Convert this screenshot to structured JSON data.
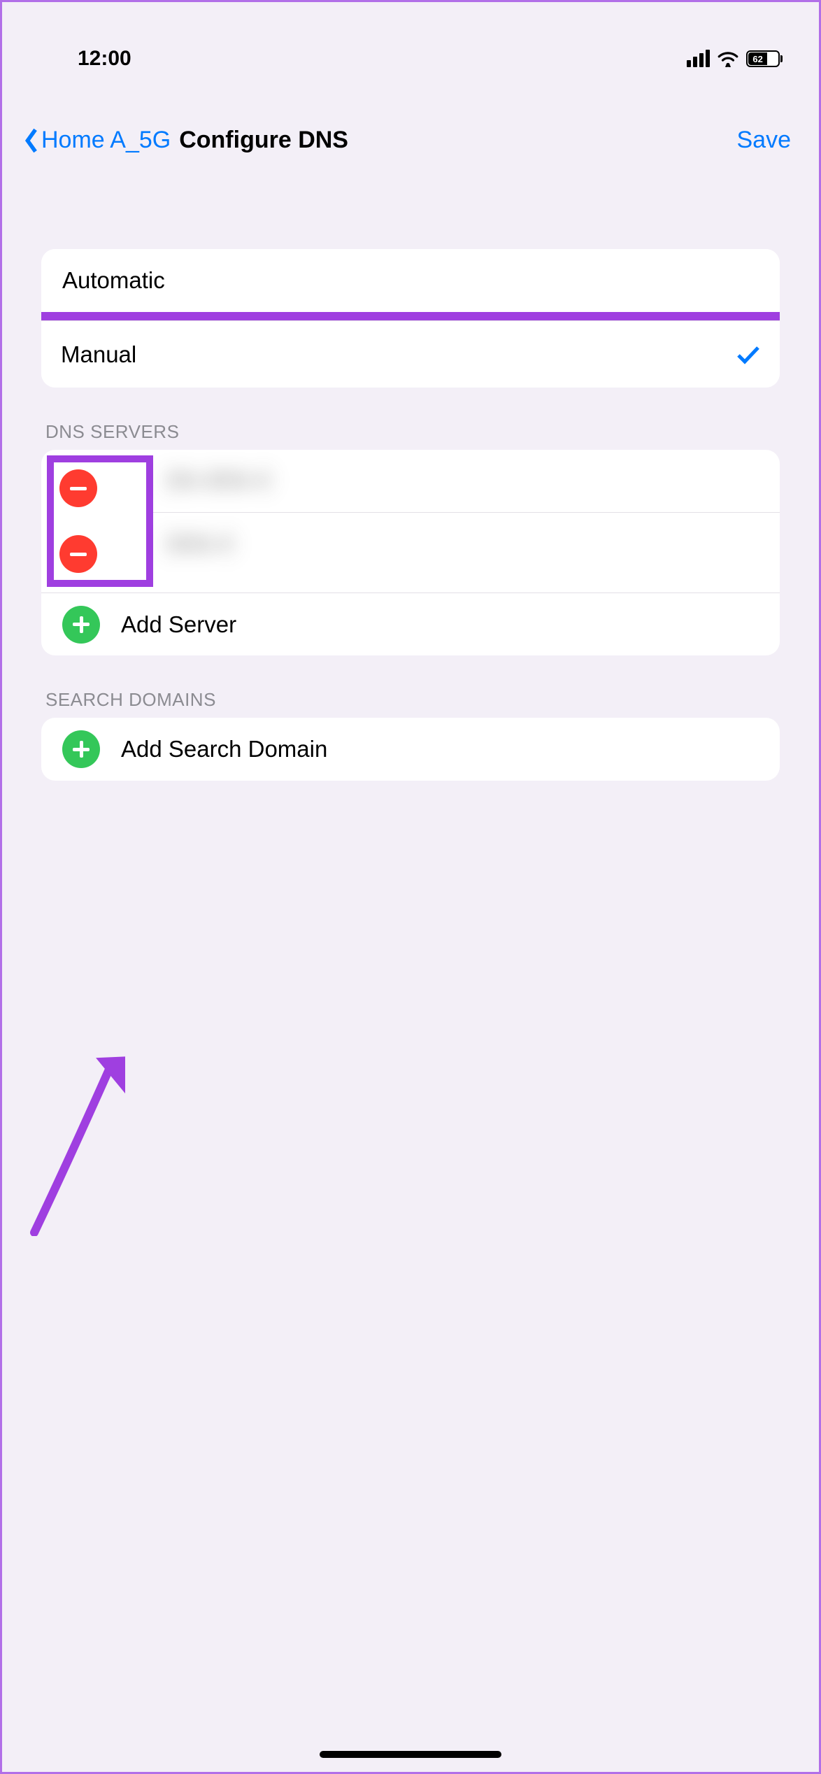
{
  "status": {
    "time": "12:00",
    "battery_pct": "62"
  },
  "nav": {
    "back_label": "Home A_5G",
    "title": "Configure DNS",
    "save": "Save"
  },
  "mode": {
    "automatic": "Automatic",
    "manual": "Manual",
    "selected": "manual"
  },
  "dns": {
    "header": "DNS SERVERS",
    "servers": [
      "",
      ""
    ],
    "add_label": "Add Server"
  },
  "search_domains": {
    "header": "SEARCH DOMAINS",
    "add_label": "Add Search Domain"
  },
  "annotations": {
    "highlight_manual": true,
    "highlight_delete_icons": true,
    "arrow_to_add_server": true
  }
}
